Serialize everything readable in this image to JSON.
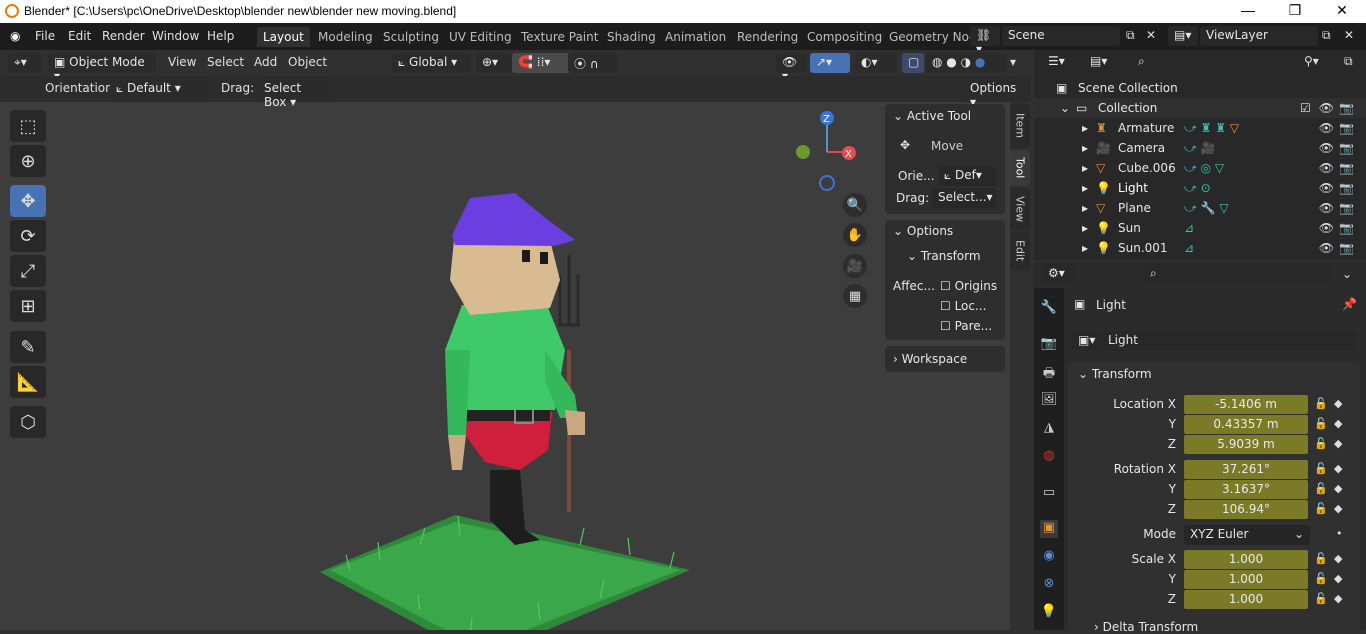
{
  "window": {
    "title": "Blender* [C:\\Users\\pc\\OneDrive\\Desktop\\blender new\\blender new moving.blend]",
    "minimize": "—",
    "maximize": "❐",
    "close": "✕"
  },
  "menu": [
    "File",
    "Edit",
    "Render",
    "Window",
    "Help"
  ],
  "workspaces": [
    "Layout",
    "Modeling",
    "Sculpting",
    "UV Editing",
    "Texture Paint",
    "Shading",
    "Animation",
    "Rendering",
    "Compositing",
    "Geometry Noc"
  ],
  "scene": {
    "name": "Scene",
    "viewlayer": "ViewLayer"
  },
  "viewport_header": {
    "mode": "Object Mode",
    "menus": [
      "View",
      "Select",
      "Add",
      "Object"
    ],
    "orientation": "Global"
  },
  "tool_settings": {
    "orientation_label": "Orientation:",
    "orientation_value": "Default",
    "drag_label": "Drag:",
    "drag_value": "Select Box",
    "options": "Options"
  },
  "npanel": {
    "active_tool": "Active Tool",
    "tool_name": "Move",
    "orient_label": "Orie...",
    "orient_value": "Def",
    "drag_label": "Drag:",
    "drag_value": "Select...",
    "options": "Options",
    "transform": "Transform",
    "affect_label": "Affec...",
    "origins": "Origins",
    "locations": "Loc...",
    "parents": "Pare...",
    "workspace": "Workspace"
  },
  "vtabs": [
    "Item",
    "Tool",
    "View",
    "Edit"
  ],
  "outliner": {
    "scene_collection": "Scene Collection",
    "collection": "Collection",
    "items": [
      "Armature",
      "Camera",
      "Cube.006",
      "Light",
      "Plane",
      "Sun",
      "Sun.001"
    ]
  },
  "properties": {
    "object_name": "Light",
    "data_name": "Light",
    "section": "Transform",
    "location_label": "Location X",
    "loc_x": "-5.1406 m",
    "loc_y": "0.43357 m",
    "loc_z": "5.9039 m",
    "rotation_label": "Rotation X",
    "rot_x": "37.261°",
    "rot_y": "3.1637°",
    "rot_z": "106.94°",
    "mode_label": "Mode",
    "mode_value": "XYZ Euler",
    "scale_label": "Scale X",
    "scale_x": "1.000",
    "scale_y": "1.000",
    "scale_z": "1.000",
    "y": "Y",
    "z": "Z",
    "delta": "Delta Transform"
  },
  "colors": {
    "accent": "#4772b3",
    "field": "#7a7a27",
    "active_object": "#e8913b"
  }
}
